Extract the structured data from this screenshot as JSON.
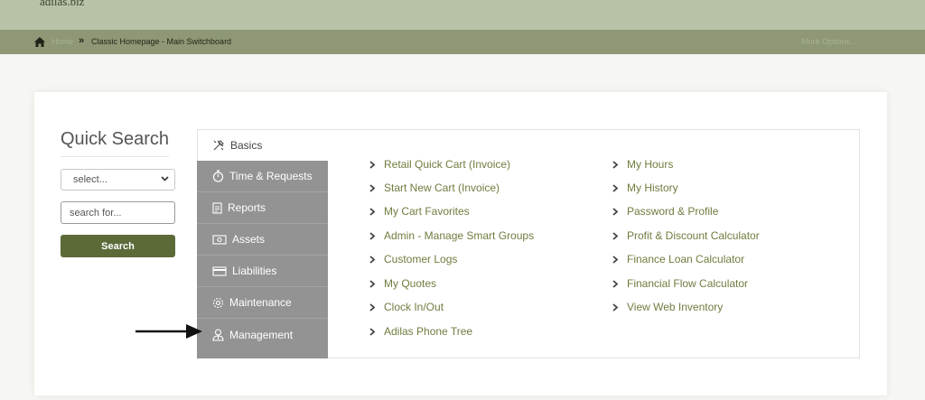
{
  "header": {
    "brand": "adilas.biz"
  },
  "breadcrumb": {
    "home": "Home",
    "separator": "»",
    "current": "Classic Homepage - Main Switchboard",
    "more_options": "More Options..."
  },
  "quick_search": {
    "title": "Quick Search",
    "select_value": "select...",
    "input_placeholder": "search for...",
    "button_label": "Search"
  },
  "tabs": [
    {
      "label": "Basics",
      "icon": "tools-icon",
      "active": true
    },
    {
      "label": "Time & Requests",
      "icon": "stopwatch-icon"
    },
    {
      "label": "Reports",
      "icon": "report-icon"
    },
    {
      "label": "Assets",
      "icon": "money-icon"
    },
    {
      "label": "Liabilities",
      "icon": "credit-card-icon"
    },
    {
      "label": "Maintenance",
      "icon": "gear-icon"
    },
    {
      "label": "Management",
      "icon": "user-tie-icon"
    }
  ],
  "links_left": [
    "Retail Quick Cart (Invoice)",
    "Start New Cart (Invoice)",
    "My Cart Favorites",
    "Admin - Manage Smart Groups",
    "Customer Logs",
    "My Quotes",
    "Clock In/Out",
    "Adilas Phone Tree"
  ],
  "links_right": [
    "My Hours",
    "My History",
    "Password & Profile",
    "Profit & Discount Calculator",
    "Finance Loan Calculator",
    "Financial Flow Calculator",
    "View Web Inventory"
  ],
  "colors": {
    "header_bg": "#b8c2a6",
    "breadcrumb_bg": "#8e9876",
    "accent_button": "#5c6a38",
    "link_color": "#6f7d3f",
    "tabs_bg": "#939393"
  }
}
